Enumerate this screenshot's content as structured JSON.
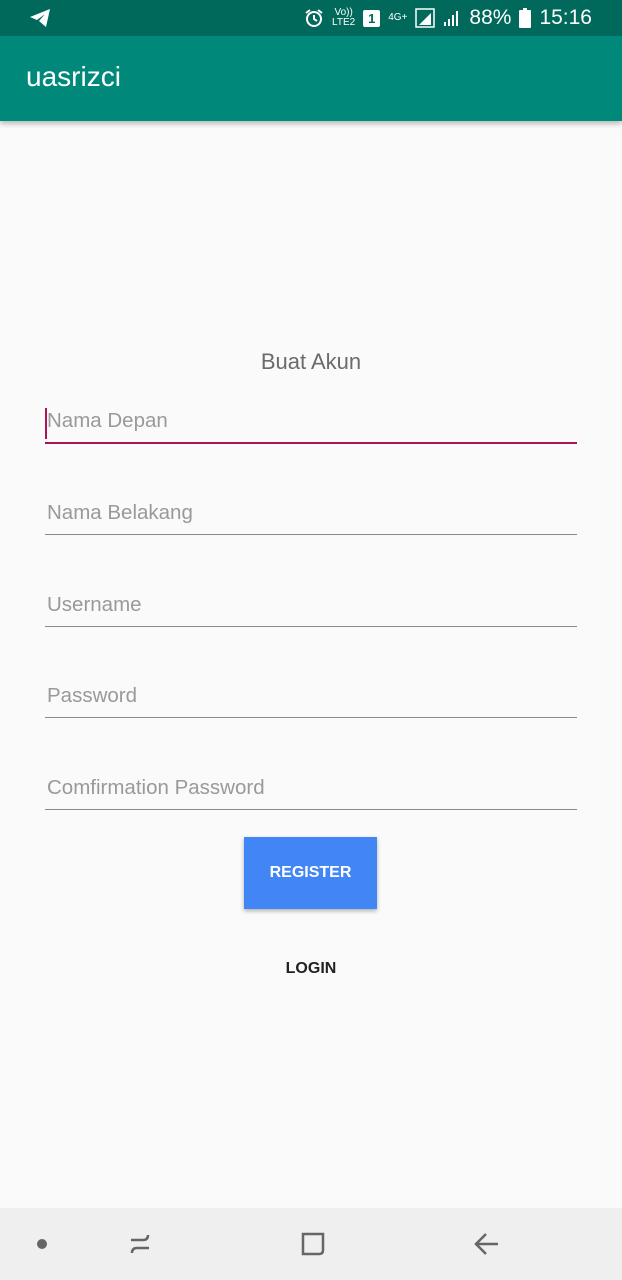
{
  "status_bar": {
    "left_icon": "telegram-icon",
    "alarm_icon": "alarm-icon",
    "volte_top": "Vo))",
    "volte_bottom": "LTE2",
    "sim_badge": "1",
    "network_label": "4G+",
    "battery_percent": "88%",
    "time": "15:16"
  },
  "app_bar": {
    "title": "uasrizci"
  },
  "form": {
    "title": "Buat Akun",
    "first_name": {
      "placeholder": "Nama Depan",
      "value": ""
    },
    "last_name": {
      "placeholder": "Nama Belakang",
      "value": ""
    },
    "username": {
      "placeholder": "Username",
      "value": ""
    },
    "password": {
      "placeholder": "Password",
      "value": ""
    },
    "confirm_password": {
      "placeholder": "Comfirmation Password",
      "value": ""
    },
    "register_label": "REGISTER",
    "login_label": "LOGIN"
  },
  "colors": {
    "status_bar": "#00695c",
    "app_bar": "#00897b",
    "accent": "#ad1457",
    "register_button": "#4285f4"
  },
  "nav_bar": {
    "items": [
      "dot-icon",
      "recent-apps-icon",
      "home-icon",
      "back-icon"
    ]
  }
}
